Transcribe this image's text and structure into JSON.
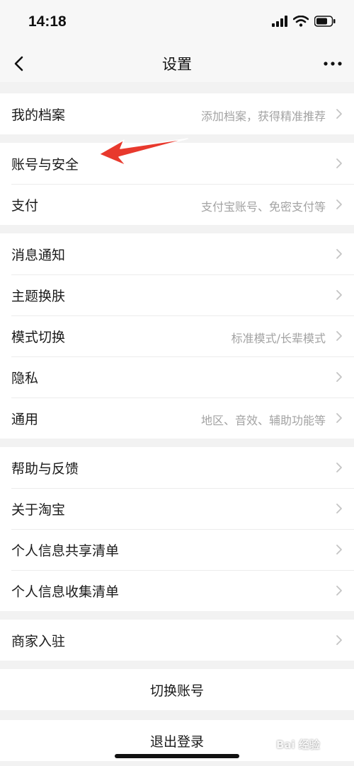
{
  "status_bar": {
    "time": "14:18"
  },
  "nav": {
    "title": "设置"
  },
  "groups": [
    {
      "rows": [
        {
          "label": "我的档案",
          "value": "添加档案，获得精准推荐"
        }
      ]
    },
    {
      "rows": [
        {
          "label": "账号与安全",
          "value": ""
        },
        {
          "label": "支付",
          "value": "支付宝账号、免密支付等"
        }
      ]
    },
    {
      "rows": [
        {
          "label": "消息通知",
          "value": ""
        },
        {
          "label": "主题换肤",
          "value": ""
        },
        {
          "label": "模式切换",
          "value": "标准模式/长辈模式"
        },
        {
          "label": "隐私",
          "value": ""
        },
        {
          "label": "通用",
          "value": "地区、音效、辅助功能等"
        }
      ]
    },
    {
      "rows": [
        {
          "label": "帮助与反馈",
          "value": ""
        },
        {
          "label": "关于淘宝",
          "value": ""
        },
        {
          "label": "个人信息共享清单",
          "value": ""
        },
        {
          "label": "个人信息收集清单",
          "value": ""
        }
      ]
    },
    {
      "rows": [
        {
          "label": "商家入驻",
          "value": ""
        }
      ]
    }
  ],
  "actions": {
    "switch_account": "切换账号",
    "logout": "退出登录"
  },
  "annotation": {
    "arrow_color": "#e8392d"
  },
  "watermark": {
    "text": "Bai 经验"
  }
}
